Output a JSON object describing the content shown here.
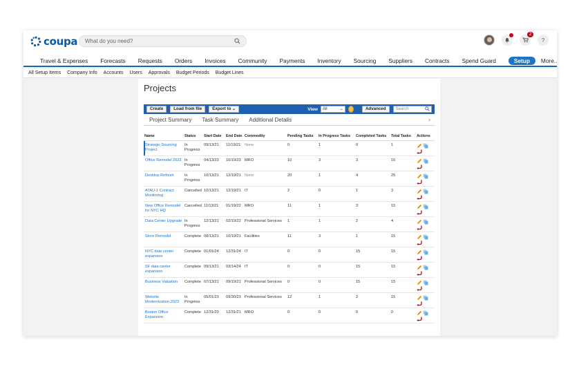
{
  "app": {
    "brand": "coupa",
    "brand_color": "#0c5aa6"
  },
  "search": {
    "placeholder": "What do you need?"
  },
  "top_icons": {
    "notifications_badge": "",
    "cart_badge": "2",
    "help_label": "?"
  },
  "nav": {
    "items": [
      "Travel & Expenses",
      "Forecasts",
      "Requests",
      "Orders",
      "Invoices",
      "Community",
      "Payments",
      "Inventory",
      "Sourcing",
      "Suppliers",
      "Contracts",
      "Spend Guard",
      "Setup",
      "More..."
    ],
    "active": "Setup"
  },
  "subnav": {
    "items": [
      "All Setup Items",
      "Company Info",
      "Accounts",
      "Users",
      "Approvals",
      "Budget Periods",
      "Budget Lines"
    ]
  },
  "page": {
    "title": "Projects"
  },
  "toolbar": {
    "create_label": "Create",
    "load_label": "Load from file",
    "export_label": "Export to ⌄",
    "view_label": "View",
    "view_value": "All",
    "advanced_label": "Advanced",
    "search_placeholder": "Search"
  },
  "tabs": [
    "Project Summary",
    "Task Summary",
    "Additional Details"
  ],
  "table": {
    "columns": [
      "Name",
      "Status",
      "Start Date",
      "End Date",
      "Commodity",
      "Pending Tasks",
      "In Progress Tasks",
      "Completed Tasks",
      "Total Tasks",
      "Actions"
    ],
    "rows": [
      {
        "name": "Strategic Sourcing Project",
        "status": "In Progress",
        "start": "09/13/21",
        "end": "11/19/21",
        "commodity": "None",
        "pending": "0",
        "in_progress": "1",
        "completed": "0",
        "total": "1"
      },
      {
        "name": "Office Remodel 2023",
        "status": "In Progress",
        "start": "04/13/23",
        "end": "10/19/23",
        "commodity": "MRO",
        "pending": "10",
        "in_progress": "3",
        "completed": "3",
        "total": "16"
      },
      {
        "name": "Desktop Refresh",
        "status": "In Progress",
        "start": "10/13/21",
        "end": "12/19/21",
        "commodity": "None",
        "pending": "20",
        "in_progress": "1",
        "completed": "4",
        "total": "25"
      },
      {
        "name": "ATAU-1 Contract Monitoring",
        "status": "Cancelled",
        "start": "10/13/21",
        "end": "12/19/21",
        "commodity": "IT",
        "pending": "2",
        "in_progress": "0",
        "completed": "1",
        "total": "3"
      },
      {
        "name": "New Office Remodel for NYC HQ",
        "status": "Cancelled",
        "start": "11/13/21",
        "end": "01/19/22",
        "commodity": "MRO",
        "pending": "11",
        "in_progress": "1",
        "completed": "3",
        "total": "15"
      },
      {
        "name": "Data Center Upgrade",
        "status": "In Progress",
        "start": "12/13/21",
        "end": "02/19/22",
        "commodity": "Professional Services",
        "pending": "1",
        "in_progress": "1",
        "completed": "2",
        "total": "4"
      },
      {
        "name": "Store Remodel",
        "status": "Complete",
        "start": "08/13/21",
        "end": "10/19/21",
        "commodity": "Facilities",
        "pending": "11",
        "in_progress": "3",
        "completed": "1",
        "total": "15"
      },
      {
        "name": "NYC data center expansion",
        "status": "Complete",
        "start": "01/01/24",
        "end": "12/31/24",
        "commodity": "IT",
        "pending": "0",
        "in_progress": "0",
        "completed": "15",
        "total": "15"
      },
      {
        "name": "SF data center expansion",
        "status": "Complete",
        "start": "09/13/21",
        "end": "03/14/24",
        "commodity": "IT",
        "pending": "0",
        "in_progress": "0",
        "completed": "15",
        "total": "15"
      },
      {
        "name": "Business Valuation",
        "status": "Complete",
        "start": "07/13/21",
        "end": "09/19/21",
        "commodity": "Professional Services",
        "pending": "0",
        "in_progress": "0",
        "completed": "15",
        "total": "15"
      },
      {
        "name": "Website Modernization 2023",
        "status": "In Progress",
        "start": "05/01/23",
        "end": "09/30/23",
        "commodity": "Professional Services",
        "pending": "12",
        "in_progress": "1",
        "completed": "2",
        "total": "15"
      },
      {
        "name": "Boston Office Expansion",
        "status": "Complete",
        "start": "12/31/20",
        "end": "12/31/21",
        "commodity": "MRO",
        "pending": "0",
        "in_progress": "0",
        "completed": "0",
        "total": "0"
      }
    ]
  },
  "colors": {
    "toolbar_bg": "#1f5fb0",
    "link": "#1a73c8",
    "nav_active": "#1e73c4",
    "pencil": "#e68a00",
    "undo": "#d0021b",
    "copy": "#6aaee8"
  }
}
